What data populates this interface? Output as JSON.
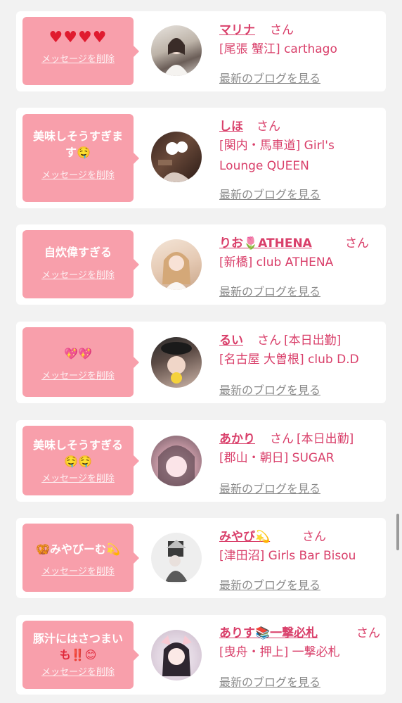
{
  "delete_label": "メッセージを削除",
  "san_label": "さん",
  "blog_label": "最新のブログを見る",
  "cards": [
    {
      "message": "♥♥♥♥",
      "name": "マリナ",
      "status": "",
      "store": "[尾張 蟹江] carthago"
    },
    {
      "message_line1": "美味しそうすぎま",
      "message_line2": "す🤤",
      "name": "しほ",
      "status": "",
      "store_line1": "[関内・馬車道] Girl's",
      "store_line2": "Lounge QUEEN"
    },
    {
      "message": "自炊偉すぎる",
      "name": "りお🌷ATHENA",
      "status": "",
      "store": "[新橋] club ATHENA"
    },
    {
      "message": "💖💖",
      "name": "るい",
      "status": "[本日出勤]",
      "store": "[名古屋 大曽根] club D.D"
    },
    {
      "message_line1": "美味しそうすぎる",
      "message_line2": "🤤🤤",
      "name": "あかり",
      "status": "[本日出勤]",
      "store": "[郡山・朝日] SUGAR"
    },
    {
      "message": "🥨みやびーむ💫",
      "name": "みやび💫",
      "status": "",
      "store": "[津田沼] Girls Bar Bisou"
    },
    {
      "message_line1": "豚汁にはさつまい",
      "message_line2": "も‼️😊",
      "name": "ありす📚一撃必札",
      "status": "",
      "store": "[曳舟・押上] 一撃必札"
    }
  ],
  "colors": {
    "bubble": "#f89fab",
    "accent": "#d93f6a",
    "link_gray": "#8a8a8a",
    "background": "#f2f2f2"
  }
}
